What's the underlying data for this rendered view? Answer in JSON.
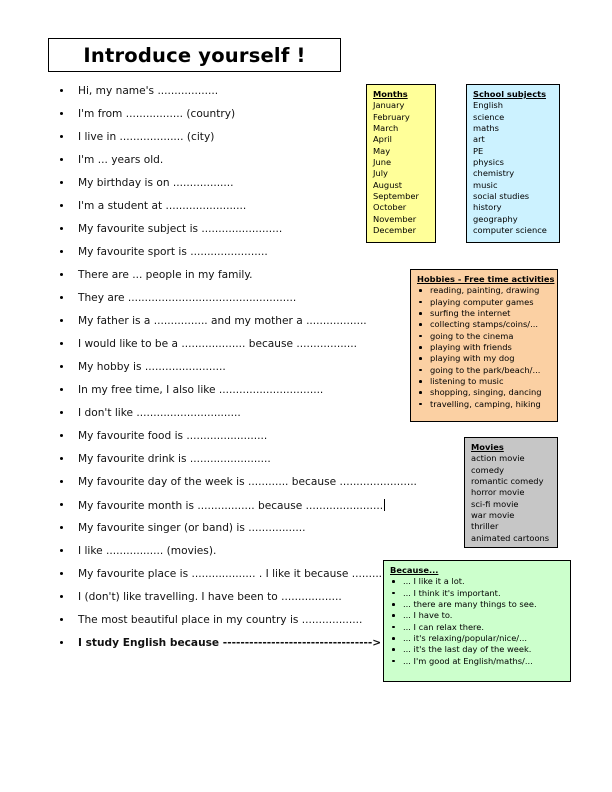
{
  "worksheet": {
    "title": "Introduce yourself !"
  },
  "prompts": [
    {
      "text": "Hi, my name's ..................",
      "bold": false,
      "caret": false
    },
    {
      "text": "I'm from ................. (country)",
      "bold": false,
      "caret": false
    },
    {
      "text": "I live in ................... (city)",
      "bold": false,
      "caret": false
    },
    {
      "text": "I'm  ...  years old.",
      "bold": false,
      "caret": false
    },
    {
      "text": "My birthday is on ..................",
      "bold": false,
      "caret": false
    },
    {
      "text": "I'm a student at ........................",
      "bold": false,
      "caret": false
    },
    {
      "text": "My favourite subject is ........................",
      "bold": false,
      "caret": false
    },
    {
      "text": "My favourite sport is .......................",
      "bold": false,
      "caret": false
    },
    {
      "text": "There are ... people in my family.",
      "bold": false,
      "caret": false
    },
    {
      "text": "They are ..................................................",
      "bold": false,
      "caret": false
    },
    {
      "text": "My father is a ................ and my mother a ..................",
      "bold": false,
      "caret": false
    },
    {
      "text": "I would like to be a ................... because ..................",
      "bold": false,
      "caret": false
    },
    {
      "text": "My hobby is ........................",
      "bold": false,
      "caret": false
    },
    {
      "text": "In my free time, I also like ...............................",
      "bold": false,
      "caret": false
    },
    {
      "text": "I don't like ...............................",
      "bold": false,
      "caret": false
    },
    {
      "text": "My favourite food is ........................",
      "bold": false,
      "caret": false
    },
    {
      "text": "My favourite drink is ........................",
      "bold": false,
      "caret": false
    },
    {
      "text": "My favourite day of the week is ............ because .......................",
      "bold": false,
      "caret": false
    },
    {
      "text": "My favourite month is ................. because .......................",
      "bold": false,
      "caret": true
    },
    {
      "text": "My favourite singer (or band) is .................",
      "bold": false,
      "caret": false
    },
    {
      "text": "I like ................. (movies).",
      "bold": false,
      "caret": false
    },
    {
      "text": "My favourite place is ...................  . I like it because .................",
      "bold": false,
      "caret": false
    },
    {
      "text": "I (don't) like travelling. I have been to ..................",
      "bold": false,
      "caret": false
    },
    {
      "text": "The most beautiful place in my country is ..................",
      "bold": false,
      "caret": false
    },
    {
      "text": "I study English because ---------------------------------->",
      "bold": true,
      "caret": false
    }
  ],
  "boxes": {
    "months": {
      "title": "Months",
      "color": "#ffff99",
      "items": [
        "January",
        "February",
        "March",
        "April",
        "May",
        "June",
        "July",
        "August",
        "September",
        "October",
        "November",
        "December"
      ]
    },
    "subjects": {
      "title": "School subjects",
      "color": "#ccf2ff",
      "items": [
        "English",
        "science",
        "maths",
        "art",
        "PE",
        "physics",
        "chemistry",
        "music",
        "social studies",
        "history",
        "geography",
        "computer science"
      ]
    },
    "hobbies": {
      "title": "Hobbies - Free time activities",
      "color": "#fbd0a3",
      "items": [
        "reading, painting, drawing",
        "playing computer games",
        "surfing the internet",
        "collecting stamps/coins/...",
        "going to the cinema",
        "playing with friends",
        "playing with my dog",
        "going to the park/beach/...",
        "listening to music",
        "shopping, singing, dancing",
        "travelling, camping, hiking"
      ]
    },
    "movies": {
      "title": "Movies",
      "color": "#c6c6c6",
      "items": [
        "action movie",
        "comedy",
        "romantic comedy",
        "horror movie",
        "sci-fi movie",
        "war movie",
        "thriller",
        "animated cartoons"
      ]
    },
    "because": {
      "title": "Because...",
      "color": "#ccffcc",
      "items": [
        "... I like it a lot.",
        "... I think it's important.",
        "... there are many things to see.",
        "... I have to.",
        "... I can relax there.",
        "... it's relaxing/popular/nice/...",
        "... it's the last day of the week.",
        "... I'm good at English/maths/..."
      ]
    }
  }
}
